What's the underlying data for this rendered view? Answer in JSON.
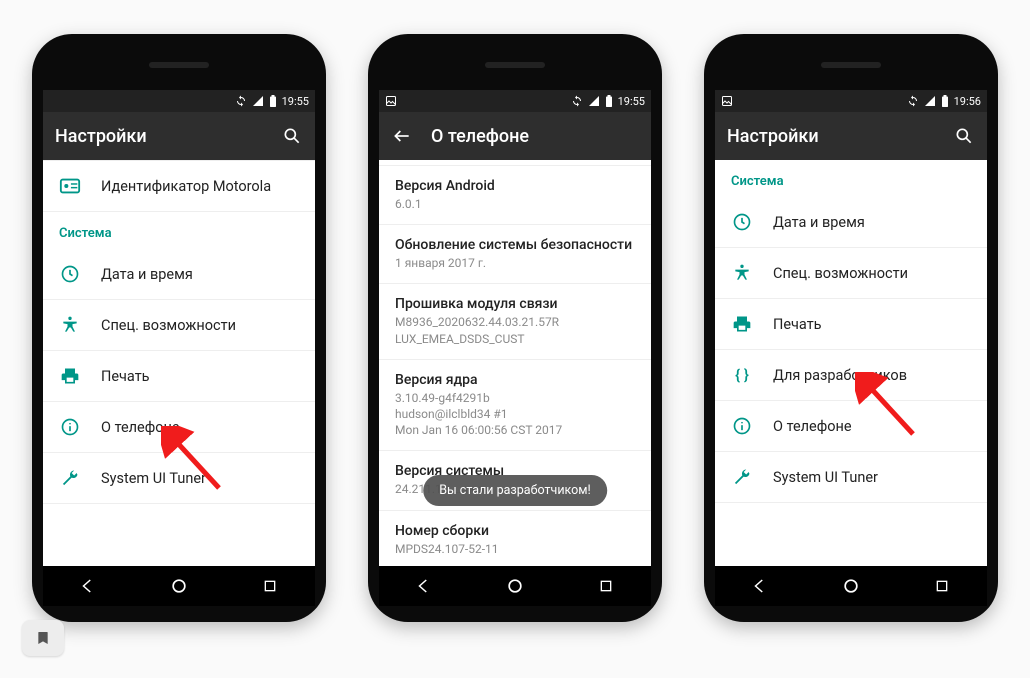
{
  "colors": {
    "accent": "#009688",
    "arrow": "#F01C1C"
  },
  "phones": [
    {
      "statusbar": {
        "time": "19:55",
        "left_icons": [],
        "right_icons": [
          "sync",
          "signal",
          "wifi",
          "battery"
        ]
      },
      "appbar": {
        "title": "Настройки",
        "back": false,
        "search": true
      },
      "top_item": {
        "label": "Идентификатор Motorola",
        "icon": "id-card"
      },
      "section": "Система",
      "items": [
        {
          "icon": "clock",
          "label": "Дата и время"
        },
        {
          "icon": "accessibility",
          "label": "Спец. возможности"
        },
        {
          "icon": "print",
          "label": "Печать"
        },
        {
          "icon": "info",
          "label": "О телефоне"
        },
        {
          "icon": "wrench",
          "label": "System UI Tuner"
        }
      ],
      "arrow_target_index": 3
    },
    {
      "statusbar": {
        "time": "19:55",
        "left_icons": [
          "picture"
        ],
        "right_icons": [
          "sync",
          "signal",
          "wifi",
          "battery"
        ]
      },
      "appbar": {
        "title": "О телефоне",
        "back": true,
        "search": false
      },
      "info": [
        {
          "title": "Версия Android",
          "sub": "6.0.1"
        },
        {
          "title": "Обновление системы безопасности",
          "sub": "1 января 2017 г."
        },
        {
          "title": "Прошивка модуля связи",
          "sub": "M8936_2020632.44.03.21.57R\nLUX_EMEA_DSDS_CUST"
        },
        {
          "title": "Версия ядра",
          "sub": "3.10.49-g4f4291b\nhudson@ilclbld34 #1\nMon Jan 16 06:00:56 CST 2017"
        },
        {
          "title": "Версия системы",
          "sub": "24.211.1…                                         …mea"
        },
        {
          "title": "Номер сборки",
          "sub": "MPDS24.107-52-11"
        }
      ],
      "toast": "Вы стали разработчиком!"
    },
    {
      "statusbar": {
        "time": "19:56",
        "left_icons": [
          "picture"
        ],
        "right_icons": [
          "sync",
          "signal",
          "wifi",
          "battery"
        ]
      },
      "appbar": {
        "title": "Настройки",
        "back": false,
        "search": true
      },
      "section": "Система",
      "items": [
        {
          "icon": "clock",
          "label": "Дата и время"
        },
        {
          "icon": "accessibility",
          "label": "Спец. возможности"
        },
        {
          "icon": "print",
          "label": "Печать"
        },
        {
          "icon": "braces",
          "label": "Для разработчиков"
        },
        {
          "icon": "info",
          "label": "О телефоне"
        },
        {
          "icon": "wrench",
          "label": "System UI Tuner"
        }
      ],
      "arrow_target_index": 3
    }
  ],
  "nav": {
    "back": "back",
    "home": "home",
    "recents": "recents"
  }
}
